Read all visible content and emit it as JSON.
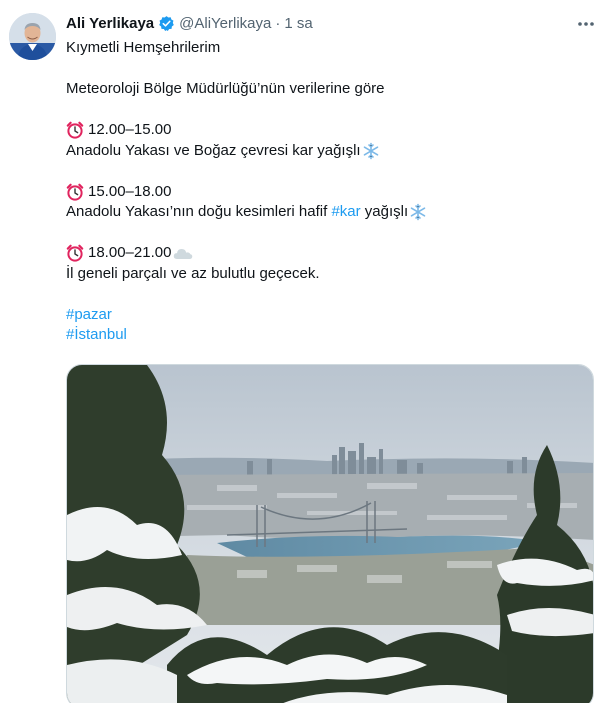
{
  "user": {
    "name": "Ali Yerlikaya",
    "handle": "@AliYerlikaya",
    "separator": "·",
    "time": "1 sa"
  },
  "icons": {
    "avatar": "avatar",
    "verified": "verified-badge-icon",
    "more": "more-options-icon",
    "clock": "alarm-clock-icon",
    "snowflake": "snowflake-icon",
    "cloud": "cloud-icon"
  },
  "colors": {
    "link": "#1d9bf0",
    "verified": "#1d9bf0",
    "text": "#0f1419",
    "muted": "#536471"
  },
  "tweet": {
    "greeting": "Kıymetli Hemşehrilerim",
    "intro": "Meteoroloji Bölge Müdürlüğü’nün verilerine göre",
    "slot1": {
      "time": "12.00–15.00",
      "text": "Anadolu Yakası ve Boğaz çevresi kar yağışlı"
    },
    "slot2": {
      "time": "15.00–18.00",
      "text_before": "Anadolu Yakası’nın doğu kesimleri hafif ",
      "hashtag": "#kar",
      "text_after": " yağışlı"
    },
    "slot3": {
      "time": "18.00–21.00",
      "text": "İl geneli parçalı ve az bulutlu geçecek."
    },
    "hashtags": [
      "#pazar",
      "#İstanbul"
    ]
  }
}
